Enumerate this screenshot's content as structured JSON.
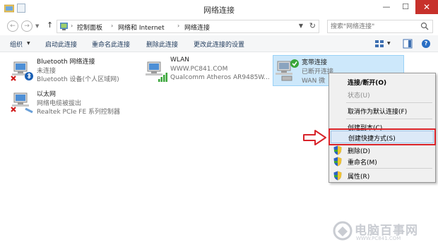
{
  "window": {
    "title": "网络连接",
    "controls": {
      "minimize": "—",
      "maximize": "☐",
      "close": "✕"
    }
  },
  "address": {
    "breadcrumbs": [
      "控制面板",
      "网络和 Internet",
      "网络连接"
    ],
    "separator": "›",
    "search_placeholder": "搜索\"网络连接\""
  },
  "commandbar": {
    "items": [
      "组织",
      "启动此连接",
      "重命名此连接",
      "删除此连接",
      "更改此连接的设置"
    ]
  },
  "connections": [
    {
      "name": "Bluetooth 网络连接",
      "status": "未连接",
      "device": "Bluetooth 设备(个人区域网)",
      "icon": "bluetooth-network-icon"
    },
    {
      "name": "WLAN",
      "status": "WWW.PC841.COM",
      "device": "Qualcomm Atheros AR9485W...",
      "icon": "wifi-network-icon"
    },
    {
      "name": "宽带连接",
      "status": "已断开连接",
      "device": "WAN 微",
      "icon": "broadband-network-icon"
    },
    {
      "name": "以太网",
      "status": "网络电缆被拔出",
      "device": "Realtek PCIe FE 系列控制器",
      "icon": "ethernet-network-icon"
    }
  ],
  "context_menu": {
    "items": [
      {
        "label": "连接/断开(O)",
        "bold": true,
        "disabled": false,
        "shield": false
      },
      {
        "label": "状态(U)",
        "bold": false,
        "disabled": true,
        "shield": false
      },
      {
        "label": "取消作为默认连接(F)",
        "bold": false,
        "disabled": false,
        "shield": false
      },
      {
        "label": "创建副本(C)",
        "bold": false,
        "disabled": false,
        "shield": false
      },
      {
        "label": "创建快捷方式(S)",
        "bold": false,
        "disabled": false,
        "shield": false,
        "highlighted": true
      },
      {
        "label": "删除(D)",
        "bold": false,
        "disabled": false,
        "shield": true
      },
      {
        "label": "重命名(M)",
        "bold": false,
        "disabled": false,
        "shield": true
      },
      {
        "label": "属性(R)",
        "bold": false,
        "disabled": false,
        "shield": true
      }
    ]
  },
  "watermark": {
    "text": "电脑百事网",
    "sub": "WWW.PC841.COM"
  },
  "colors": {
    "accent": "#1e395b",
    "selection": "#cde8fb",
    "callout": "#d8232a",
    "close": "#c7312b"
  }
}
